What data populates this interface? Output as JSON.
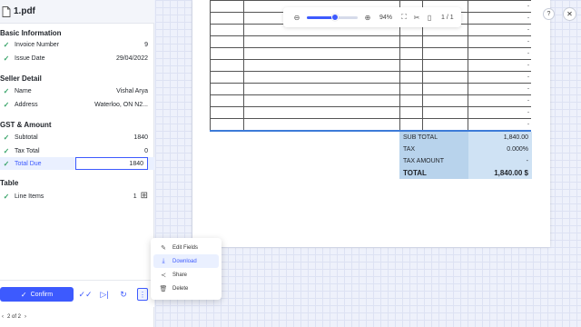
{
  "file": {
    "name": "1.pdf"
  },
  "sections": {
    "basic": {
      "title": "Basic Information",
      "invoice_number": {
        "label": "Invoice Number",
        "value": "9"
      },
      "issue_date": {
        "label": "Issue Date",
        "value": "29/04/2022"
      }
    },
    "seller": {
      "title": "Seller Detail",
      "name": {
        "label": "Name",
        "value": "Vishal Arya"
      },
      "address": {
        "label": "Address",
        "value": "Waterloo, ON N2..."
      }
    },
    "gst": {
      "title": "GST & Amount",
      "subtotal": {
        "label": "Subtotal",
        "value": "1840"
      },
      "tax_total": {
        "label": "Tax Total",
        "value": "0"
      },
      "total_due": {
        "label": "Total Due",
        "value": "1840"
      }
    },
    "table": {
      "title": "Table",
      "line_items": {
        "label": "Line Items",
        "value": "1"
      }
    }
  },
  "actions": {
    "confirm_label": "Confirm"
  },
  "pager": {
    "text": "2 of 2"
  },
  "toolbar": {
    "zoom": "94%",
    "zoom_level": 0.55,
    "page": "1",
    "page_sep": "/",
    "pages": "1"
  },
  "document": {
    "row_amounts": [
      "-",
      "-",
      "-",
      "-",
      "-",
      "-",
      "-",
      "-",
      "-",
      "-",
      "-"
    ],
    "totals": [
      {
        "label": "SUB TOTAL",
        "value": "1,840.00"
      },
      {
        "label": "TAX",
        "value": "0.000%"
      },
      {
        "label": "TAX AMOUNT",
        "value": "-"
      },
      {
        "label": "TOTAL",
        "value": "1,840.00  $"
      }
    ]
  },
  "menu": {
    "items": [
      {
        "label": "Edit Fields",
        "icon": "pencil-icon"
      },
      {
        "label": "Download",
        "icon": "download-icon"
      },
      {
        "label": "Share",
        "icon": "share-icon"
      },
      {
        "label": "Delete",
        "icon": "trash-icon"
      }
    ]
  },
  "help": {
    "label": "?"
  },
  "colors": {
    "accent": "#3d5afe",
    "check": "#3aa56a",
    "totals_label_bg": "#b8d3ec",
    "totals_value_bg": "#cfe2f4"
  }
}
